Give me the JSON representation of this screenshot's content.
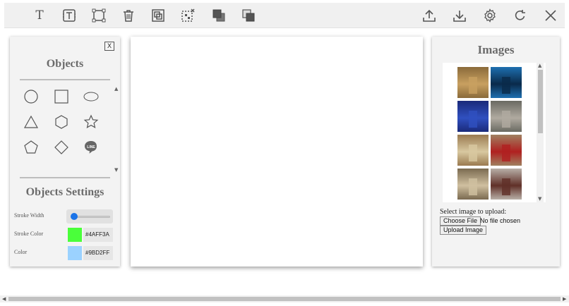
{
  "toolbar": {
    "left_tools": [
      {
        "name": "text-tool",
        "label": "T"
      },
      {
        "name": "textbox-tool"
      },
      {
        "name": "crop-tool"
      },
      {
        "name": "delete-tool"
      },
      {
        "name": "group-tool"
      },
      {
        "name": "ungroup-tool"
      },
      {
        "name": "bring-forward-tool"
      },
      {
        "name": "send-backward-tool"
      }
    ],
    "right_tools": [
      "upload-icon",
      "download-icon",
      "gear-icon",
      "refresh-icon",
      "close-icon"
    ]
  },
  "objects_panel": {
    "close_label": "X",
    "title": "Objects",
    "shapes": [
      "circle",
      "square",
      "ellipse",
      "triangle",
      "hexagon",
      "star",
      "pentagon",
      "diamond",
      "line-badge"
    ],
    "line_badge_text": "LINE",
    "settings_title": "Objects Settings",
    "stroke_width_label": "Stroke Width",
    "stroke_width_value": 0.05,
    "stroke_color_label": "Stroke Color",
    "stroke_color_value": "#4AFF3A",
    "color_label": "Color",
    "color_value": "#9BD2FF"
  },
  "images_panel": {
    "title": "Images",
    "thumbnails": [
      {
        "name": "hall-gold",
        "bg": "#8a6a3a",
        "accent": "#c8a060"
      },
      {
        "name": "blue-car",
        "bg": "#1e6fb0",
        "accent": "#0a2a4a"
      },
      {
        "name": "stage-blue",
        "bg": "#1a2a7a",
        "accent": "#3050c0"
      },
      {
        "name": "building-facade",
        "bg": "#6a6a62",
        "accent": "#b0aaa0"
      },
      {
        "name": "grand-lobby",
        "bg": "#9a7a50",
        "accent": "#d8c8a0"
      },
      {
        "name": "staircase-red",
        "bg": "#a08060",
        "accent": "#b02020"
      },
      {
        "name": "bedroom-canopy",
        "bg": "#7a6a50",
        "accent": "#d0c0a0"
      },
      {
        "name": "bedroom-white",
        "bg": "#b8b0a8",
        "accent": "#603028"
      }
    ],
    "upload_label": "Select image to upload:",
    "choose_file_label": "Choose File",
    "no_file_label": "No file chosen",
    "upload_button_label": "Upload Image"
  }
}
